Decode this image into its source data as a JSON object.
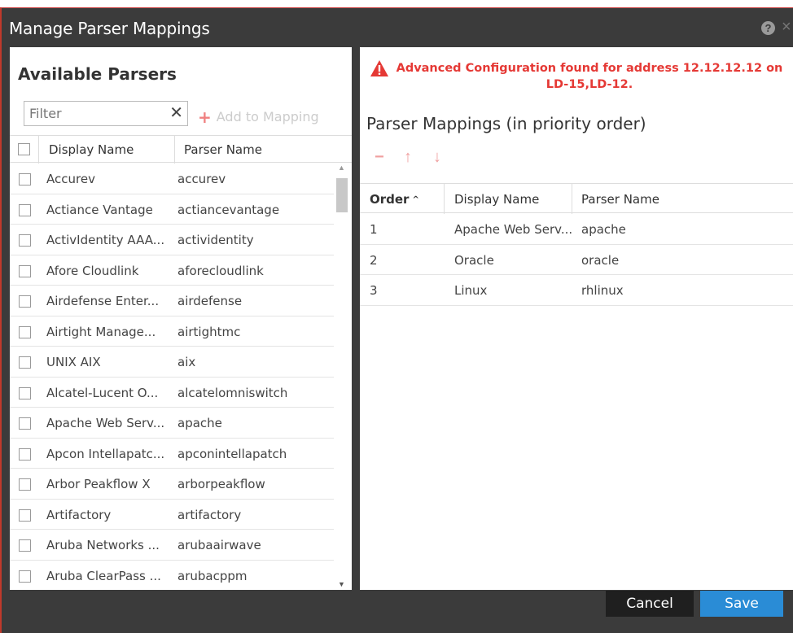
{
  "dialog": {
    "title": "Manage Parser Mappings",
    "help_icon": "?",
    "close_icon": "×"
  },
  "available": {
    "title": "Available Parsers",
    "filter_placeholder": "Filter",
    "clear_icon": "✕",
    "add_label": "Add to Mapping",
    "add_icon": "+",
    "columns": [
      "Display Name",
      "Parser Name"
    ],
    "rows": [
      {
        "display": "Accurev",
        "parser": "accurev"
      },
      {
        "display": "Actiance Vantage",
        "parser": "actiancevantage"
      },
      {
        "display": "ActivIdentity AAA...",
        "parser": "actividentity"
      },
      {
        "display": "Afore Cloudlink",
        "parser": "aforecloudlink"
      },
      {
        "display": "Airdefense Enter...",
        "parser": "airdefense"
      },
      {
        "display": "Airtight Manage...",
        "parser": "airtightmc"
      },
      {
        "display": "UNIX AIX",
        "parser": "aix"
      },
      {
        "display": "Alcatel-Lucent O...",
        "parser": "alcatelomniswitch"
      },
      {
        "display": "Apache Web Serv...",
        "parser": "apache"
      },
      {
        "display": "Apcon Intellapatc...",
        "parser": "apconintellapatch"
      },
      {
        "display": "Arbor Peakflow X",
        "parser": "arborpeakflow"
      },
      {
        "display": "Artifactory",
        "parser": "artifactory"
      },
      {
        "display": "Aruba Networks ...",
        "parser": "arubaairwave"
      },
      {
        "display": "Aruba ClearPass ...",
        "parser": "arubacppm"
      }
    ]
  },
  "warning": {
    "text": "Advanced Configuration found for address 12.12.12.12 on LD-15,LD-12.",
    "color": "#e53935"
  },
  "mappings": {
    "title": "Parser Mappings (in priority order)",
    "toolbar": {
      "remove_icon": "−",
      "up_icon": "↑",
      "down_icon": "↓"
    },
    "columns": [
      "Order",
      "Display Name",
      "Parser Name"
    ],
    "sort_icon": "^",
    "rows": [
      {
        "order": "1",
        "display": "Apache Web Serv...",
        "parser": "apache"
      },
      {
        "order": "2",
        "display": "Oracle",
        "parser": "oracle"
      },
      {
        "order": "3",
        "display": "Linux",
        "parser": "rhlinux"
      }
    ]
  },
  "footer": {
    "cancel_label": "Cancel",
    "save_label": "Save",
    "save_color": "#2a8cd6"
  }
}
